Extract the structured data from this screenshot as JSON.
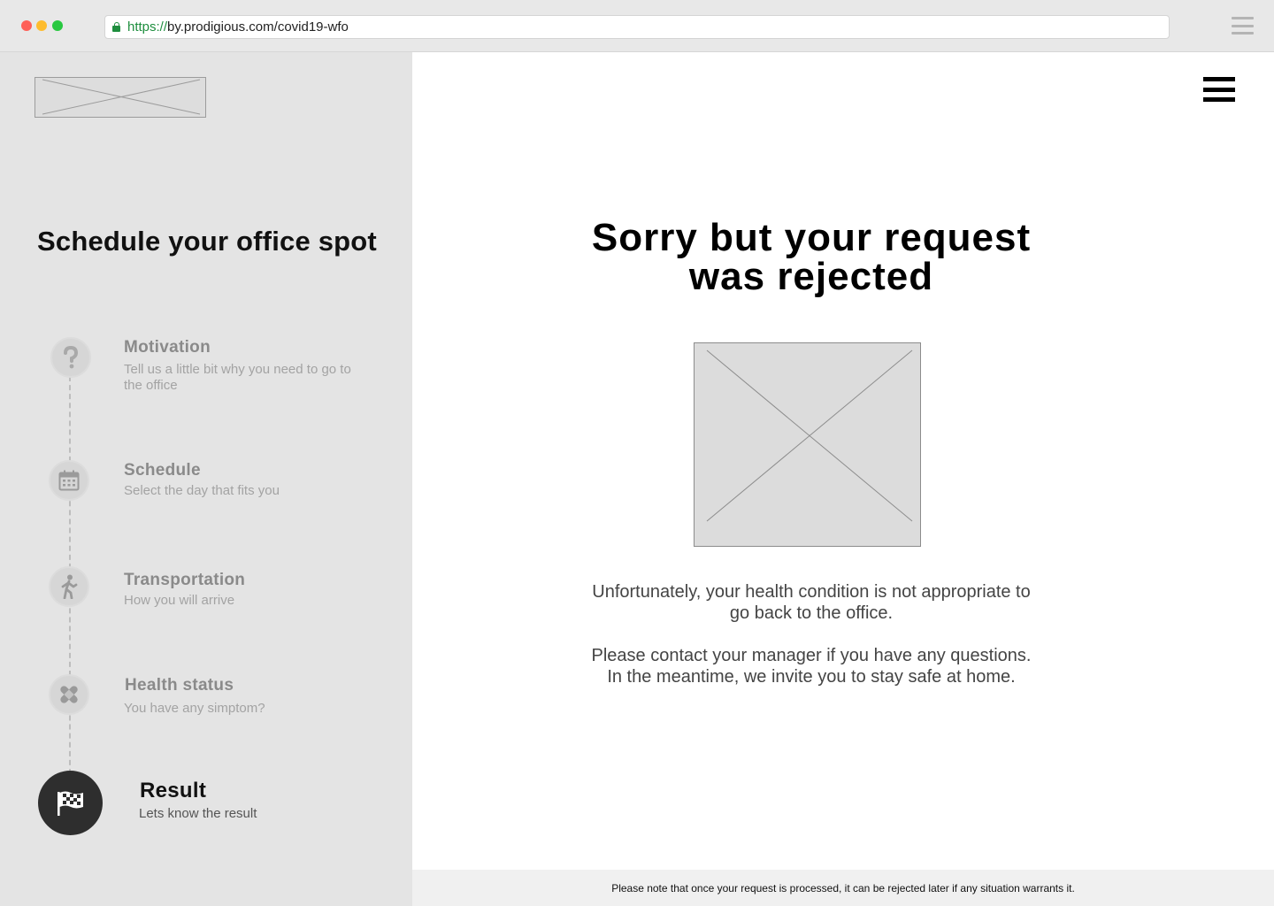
{
  "browser": {
    "url_scheme": "https://",
    "url_rest": "by.prodigious.com/covid19-wfo",
    "icons": [
      "lock-icon",
      "browser-menu-icon"
    ]
  },
  "sidebar": {
    "title": "Schedule your office spot",
    "steps": [
      {
        "title": "Motivation",
        "desc": "Tell us a little bit why you need to go to the office",
        "icon": "question-icon",
        "state": "done"
      },
      {
        "title": "Schedule",
        "desc": "Select the day that fits you",
        "icon": "calendar-icon",
        "state": "done"
      },
      {
        "title": "Transportation",
        "desc": "How you will arrive",
        "icon": "walking-person-icon",
        "state": "done"
      },
      {
        "title": "Health status",
        "desc": "You have any simptom?",
        "icon": "bandage-icon",
        "state": "done"
      },
      {
        "title": "Result",
        "desc": "Lets know the result",
        "icon": "checkered-flag-icon",
        "state": "active"
      }
    ]
  },
  "main": {
    "title_line1": "Sorry but your request",
    "title_line2": "was rejected",
    "message1": "Unfortunately, your health condition is not appropriate to go back to the office.",
    "message2_line1": "Please contact your manager if you have any questions.",
    "message2_line2": "In the meantime, we invite you to stay safe at home.",
    "footer_note": "Please note that once your request is processed, it can be rejected later if any situation warrants it."
  },
  "colors": {
    "sidebar_bg": "#e4e4e4",
    "active_step": "#2e2e2e",
    "inactive_step": "#8a8a8a",
    "url_secure": "#1e8e3e"
  }
}
